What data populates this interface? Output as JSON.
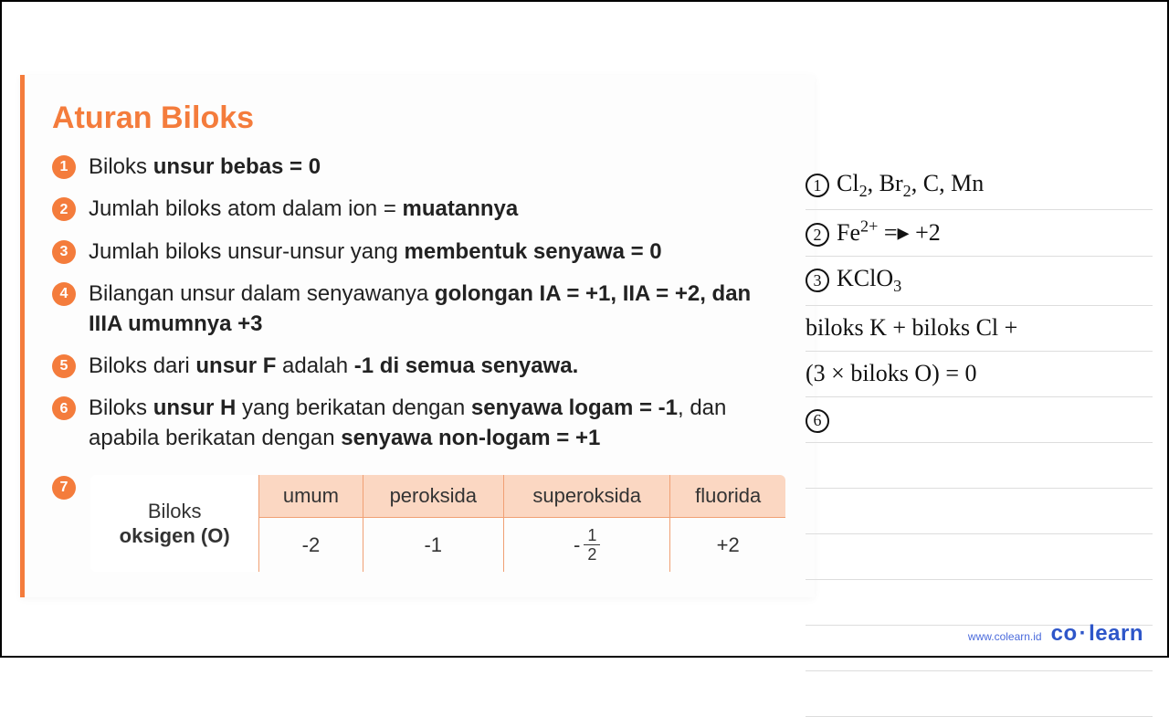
{
  "title": "Aturan Biloks",
  "rules": [
    {
      "n": "1",
      "html": "Biloks <b>unsur bebas = 0</b>"
    },
    {
      "n": "2",
      "html": "Jumlah biloks atom dalam ion = <b>muatannya</b>"
    },
    {
      "n": "3",
      "html": "Jumlah biloks unsur-unsur yang <b>membentuk senyawa = 0</b>"
    },
    {
      "n": "4",
      "html": "Bilangan unsur dalam senyawanya <b>golongan IA = +1, IIA = +2, dan IIIA umumnya +3</b>"
    },
    {
      "n": "5",
      "html": "Biloks dari <b>unsur F</b> adalah <b>-1 di semua senyawa.</b>"
    },
    {
      "n": "6",
      "html": "Biloks <b>unsur H</b> yang berikatan dengan <b>senyawa logam = -1</b>, dan apabila berikatan dengan <b>senyawa non-logam = +1</b>"
    }
  ],
  "table": {
    "bullet": "7",
    "rowhead_line1": "Biloks",
    "rowhead_line2": "oksigen (O)",
    "headers": [
      "umum",
      "peroksida",
      "superoksida",
      "fluorida"
    ],
    "values": [
      "-2",
      "-1",
      "-1/2",
      "+2"
    ]
  },
  "handwriting": {
    "lines": [
      {
        "circ": "1",
        "html": "Cl<sub>2</sub>, Br<sub>2</sub>, C, Mn"
      },
      {
        "circ": "2",
        "html": "Fe<sup>2+</sup> =▸ +2"
      },
      {
        "circ": "3",
        "html": "KClO<sub>3</sub>"
      },
      {
        "circ": "",
        "html": "biloks K + biloks Cl +"
      },
      {
        "circ": "",
        "html": "(3 × biloks O) = 0"
      },
      {
        "circ": "6",
        "html": ""
      }
    ],
    "blank_lines": 6
  },
  "footer": {
    "url": "www.colearn.id",
    "logo_left": "co",
    "logo_right": "learn"
  }
}
